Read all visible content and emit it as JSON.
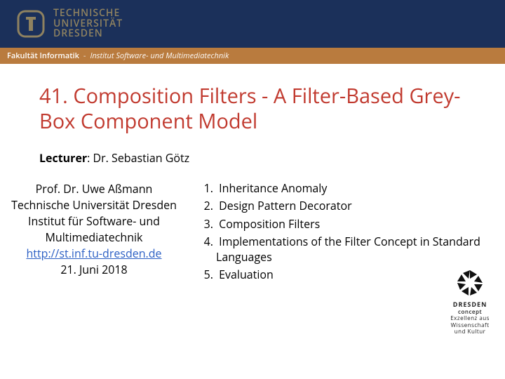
{
  "university": {
    "line1": "TECHNISCHE",
    "line2": "UNIVERSITÄT",
    "line3": "DRESDEN"
  },
  "breadcrumb": {
    "faculty": "Fakultät Informatik",
    "sep": "-",
    "institute": "Institut Software- und Multimediatechnik"
  },
  "title": "41. Composition Filters - A Filter-Based Grey-Box Component Model",
  "lecturer": {
    "label": "Lecturer",
    "name": "Dr. Sebastian Götz"
  },
  "author": {
    "name": "Prof. Dr. Uwe Aßmann",
    "affil1": "Technische Universität Dresden",
    "affil2": "Institut für Software- und Multimediatechnik",
    "url": "http://st.inf.tu-dresden.de",
    "date": "21. Juni 2018"
  },
  "outline": [
    "Inheritance Anomaly",
    "Design Pattern Decorator",
    "Composition Filters",
    "Implementations of the Filter Concept in Standard Languages",
    "Evaluation"
  ],
  "concept": {
    "l1": "DRESDEN",
    "l2": "concept",
    "l3": "Exzellenz aus",
    "l4": "Wissenschaft",
    "l5": "und Kultur"
  }
}
